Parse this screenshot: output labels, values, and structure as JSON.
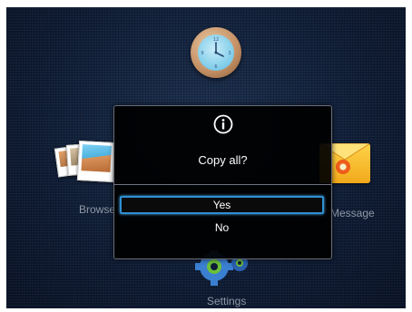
{
  "menu": {
    "browse_label": "Browse",
    "message_label": "Message",
    "settings_label": "Settings"
  },
  "icons": {
    "clock": "clock-icon",
    "browse": "photos-icon",
    "message": "envelope-icon",
    "settings": "gears-icon",
    "info": "info-icon"
  },
  "dialog": {
    "prompt": "Copy all?",
    "options": [
      {
        "label": "Yes",
        "selected": true
      },
      {
        "label": "No",
        "selected": false
      }
    ]
  },
  "colors": {
    "background": "#0f1c35",
    "dialog_bg": "#000000",
    "selection_border": "#2e8fd1",
    "label_text": "#8e97a6"
  }
}
